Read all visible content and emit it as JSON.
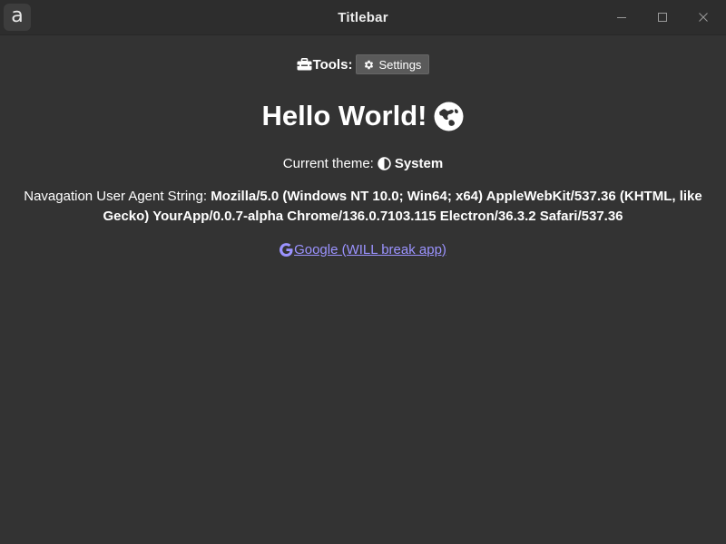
{
  "window": {
    "title": "Titlebar",
    "app_icon_letter": "a"
  },
  "toolbar": {
    "tools_label": "Tools:",
    "settings_label": "Settings"
  },
  "main": {
    "heading": "Hello World!",
    "theme_prefix": "Current theme:",
    "theme_value": "System",
    "ua_prefix": "Navagation User Agent String:",
    "ua_value": "Mozilla/5.0 (Windows NT 10.0; Win64; x64) AppleWebKit/537.36 (KHTML, like Gecko) YourApp/0.0.7-alpha Chrome/136.0.7103.115 Electron/36.3.2 Safari/537.36",
    "google_link": "Google (WILL break app)"
  },
  "icons": {
    "app": "app-a-icon",
    "minimize": "minimize-icon",
    "maximize": "maximize-icon",
    "close": "close-icon",
    "tools": "toolbox-icon",
    "settings": "gear-icon",
    "globe": "globe-icon",
    "theme": "half-circle-contrast-icon",
    "google": "google-g-icon"
  },
  "colors": {
    "background": "#333333",
    "titlebar": "#2d2d2d",
    "button": "#5a5a5a",
    "link": "#9b93ff",
    "text": "#ffffff"
  }
}
